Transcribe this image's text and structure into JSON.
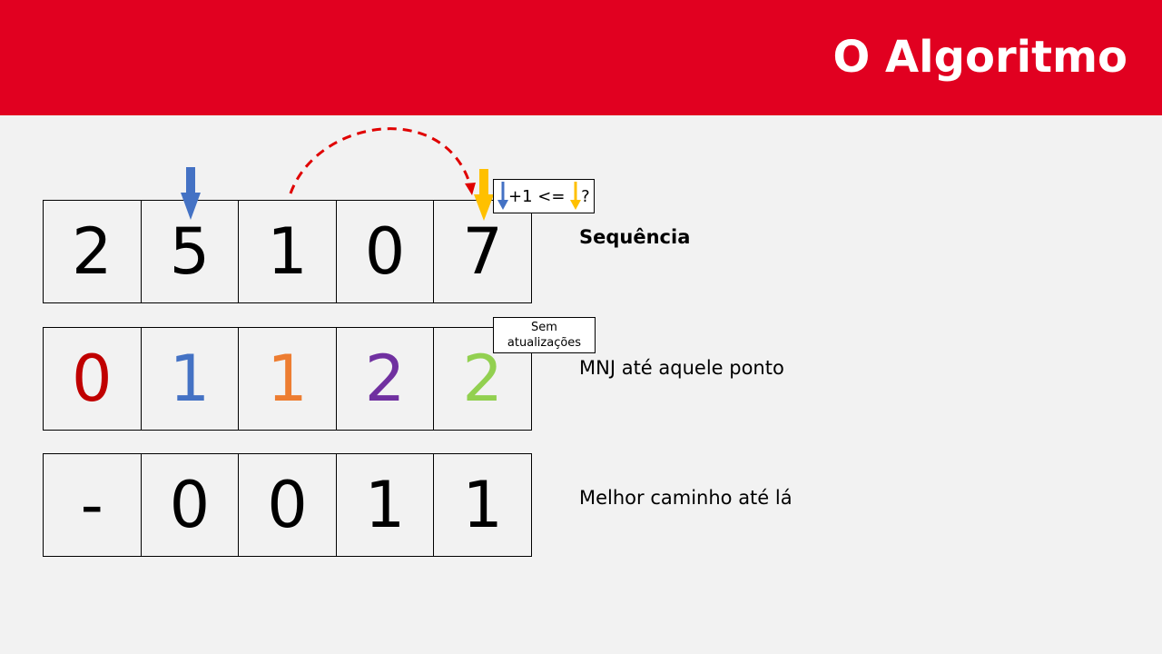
{
  "header": {
    "title": "O Algoritmo",
    "color": "#e10020"
  },
  "rows": [
    {
      "label": "Sequência",
      "cells": [
        {
          "text": "2",
          "color": "#000000"
        },
        {
          "text": "5",
          "color": "#000000"
        },
        {
          "text": "1",
          "color": "#000000"
        },
        {
          "text": "0",
          "color": "#000000"
        },
        {
          "text": "7",
          "color": "#000000"
        }
      ]
    },
    {
      "label": "MNJ até aquele ponto",
      "cells": [
        {
          "text": "0",
          "color": "#c00000"
        },
        {
          "text": "1",
          "color": "#4472c4"
        },
        {
          "text": "1",
          "color": "#ed7d31"
        },
        {
          "text": "2",
          "color": "#7030a0"
        },
        {
          "text": "2",
          "color": "#92d050"
        }
      ]
    },
    {
      "label": "Melhor caminho até lá",
      "cells": [
        {
          "text": "-",
          "color": "#000000"
        },
        {
          "text": "0",
          "color": "#000000"
        },
        {
          "text": "0",
          "color": "#000000"
        },
        {
          "text": "1",
          "color": "#000000"
        },
        {
          "text": "1",
          "color": "#000000"
        }
      ]
    }
  ],
  "comparison": {
    "text_mid": "+1 <= ",
    "text_end": "?"
  },
  "note": {
    "line1": "Sem",
    "line2": "atualizações"
  },
  "arrows": {
    "blue": "#4472c4",
    "yellow": "#ffc000",
    "arc": "#e00000"
  }
}
